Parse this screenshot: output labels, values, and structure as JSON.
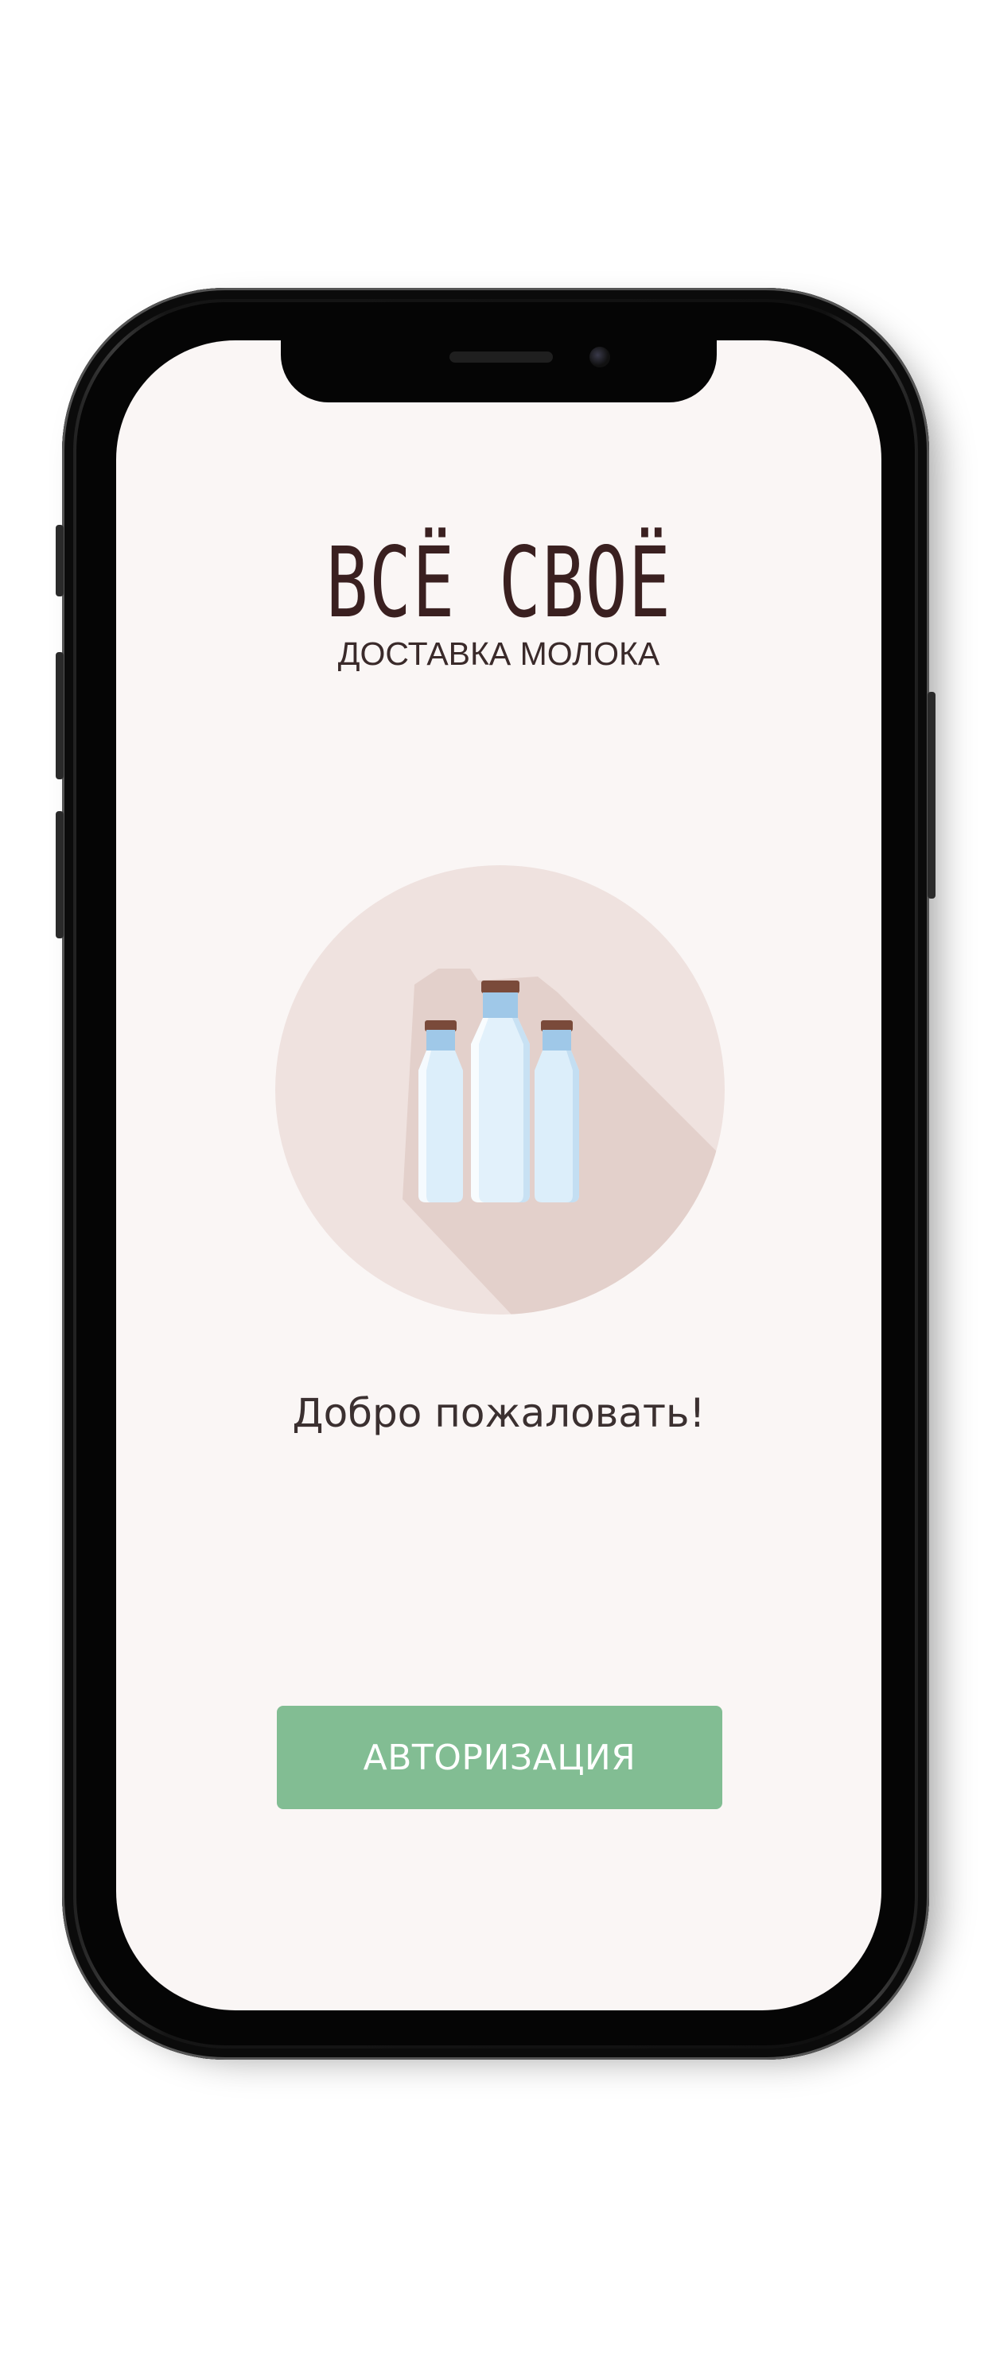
{
  "app": {
    "logo_title": "ВСЁ СВОЁ",
    "logo_subtitle": "ДОСТАВКА МОЛОКА"
  },
  "illustration": {
    "icon": "milk-bottles-icon",
    "circle_color": "#efe2df",
    "shadow_color": "#e2cfca",
    "bottle_color": "#dceefa",
    "cap_color": "#7a4a3a"
  },
  "main": {
    "welcome_text": "Добро пожаловать!",
    "auth_button_label": "АВТОРИЗАЦИЯ"
  },
  "colors": {
    "background": "#faf6f5",
    "accent": "#82bd93",
    "text": "#3b3030"
  }
}
